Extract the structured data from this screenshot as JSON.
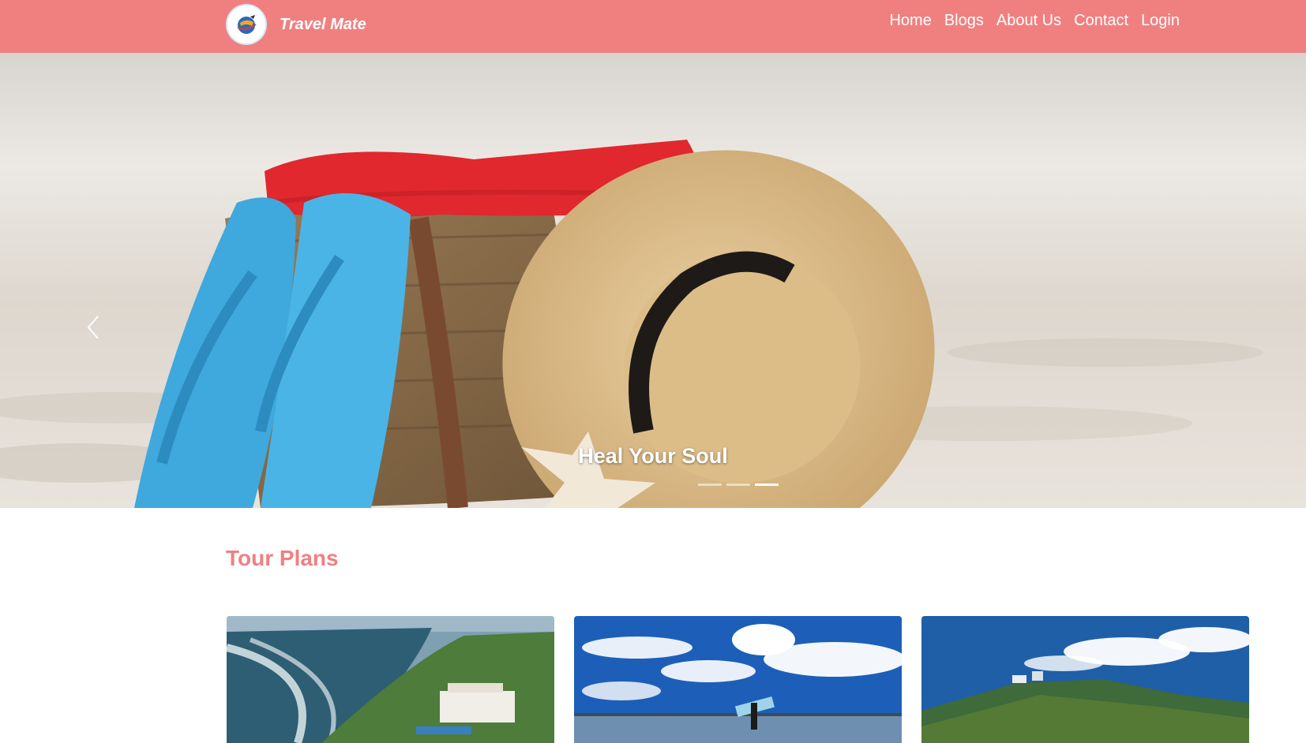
{
  "brand": {
    "name": "Travel Mate",
    "logo_icon": "globe-plane-icon"
  },
  "nav": {
    "items": [
      "Home",
      "Blogs",
      "About Us",
      "Contact",
      "Login"
    ]
  },
  "hero": {
    "caption": "Heal Your Soul",
    "prev_icon": "chevron-left-icon",
    "slide_count": 3,
    "active_slide": 3
  },
  "tour_plans": {
    "title": "Tour Plans",
    "cards": [
      {
        "image": "coastal-resort-aerial"
      },
      {
        "image": "surfer-on-beach-blue-sky"
      },
      {
        "image": "green-hill-summit"
      }
    ]
  },
  "colors": {
    "accent": "#f08080",
    "text_on_accent": "#ffffff"
  }
}
